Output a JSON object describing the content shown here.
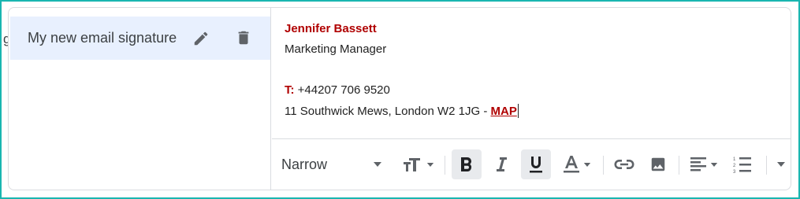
{
  "sidebar": {
    "partial_label": "g",
    "selected_signature": "My new email signature"
  },
  "signature": {
    "name": "Jennifer Bassett",
    "job_title": "Marketing Manager",
    "phone_label": "T:",
    "phone_number": " +44207 706 9520",
    "address": "11 Southwick Mews, London W2 1JG - ",
    "map_link": "MAP"
  },
  "toolbar": {
    "font": "Narrow",
    "bold_active": true,
    "underline_active": true
  },
  "colors": {
    "accent_red": "#b00000",
    "selected_row": "#e8f0fe",
    "frame_border": "#19b6b0",
    "icon": "#5f6368"
  }
}
